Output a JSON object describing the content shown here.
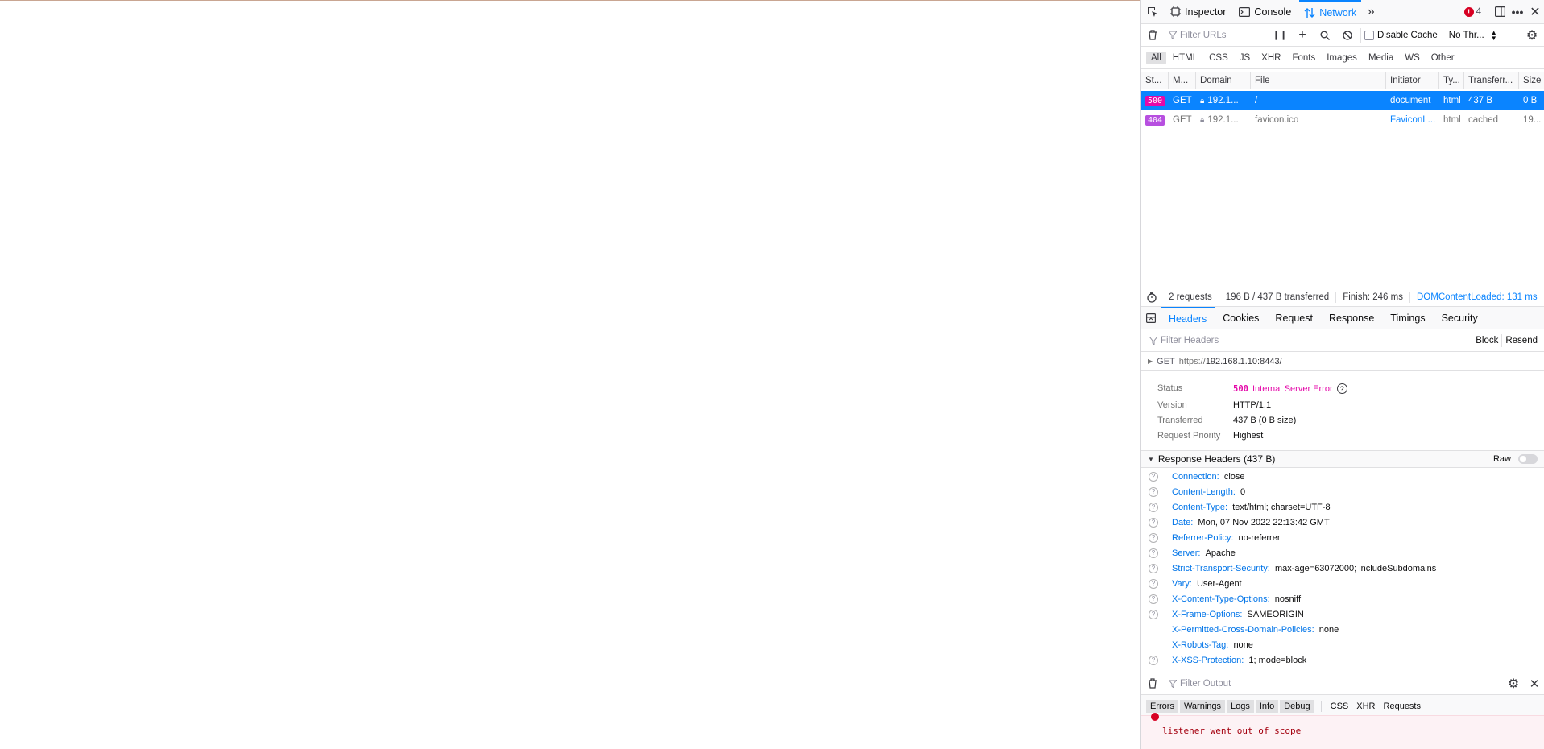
{
  "toolbar": {
    "tabs": [
      {
        "label": "Inspector",
        "icon": "inspector-icon"
      },
      {
        "label": "Console",
        "icon": "console-icon"
      },
      {
        "label": "Network",
        "icon": "network-icon"
      }
    ],
    "error_count": "4"
  },
  "filter": {
    "placeholder": "Filter URLs",
    "disable_cache": "Disable Cache",
    "throttle": "No Thr..."
  },
  "type_filters": [
    "All",
    "HTML",
    "CSS",
    "JS",
    "XHR",
    "Fonts",
    "Images",
    "Media",
    "WS",
    "Other"
  ],
  "table": {
    "headers": [
      "St...",
      "M...",
      "Domain",
      "File",
      "Initiator",
      "Ty...",
      "Transferr...",
      "Size"
    ],
    "rows": [
      {
        "status": "500",
        "method": "GET",
        "domain": "192.1...",
        "file": "/",
        "initiator": "document",
        "type": "html",
        "transferred": "437 B",
        "size": "0 B"
      },
      {
        "status": "404",
        "method": "GET",
        "domain": "192.1...",
        "file": "favicon.ico",
        "initiator": "FaviconL...",
        "type": "html",
        "transferred": "cached",
        "size": "19..."
      }
    ]
  },
  "summary": {
    "requests": "2 requests",
    "transferred": "196 B / 437 B transferred",
    "finish": "Finish: 246 ms",
    "dcl": "DOMContentLoaded: 131 ms"
  },
  "details": {
    "tabs": [
      "Headers",
      "Cookies",
      "Request",
      "Response",
      "Timings",
      "Security"
    ],
    "filter_placeholder": "Filter Headers",
    "block": "Block",
    "resend": "Resend",
    "request_method": "GET",
    "request_url_prefix": "https://",
    "request_url_host": "192.168.1.10:8443/",
    "status_label": "Status",
    "status_code": "500",
    "status_text": "Internal Server Error",
    "version_label": "Version",
    "version": "HTTP/1.1",
    "transferred_label": "Transferred",
    "transferred": "437 B (0 B size)",
    "priority_label": "Request Priority",
    "priority": "Highest",
    "response_headers_title": "Response Headers (437 B)",
    "raw_label": "Raw",
    "headers": [
      {
        "name": "Connection:",
        "value": "close",
        "help": true
      },
      {
        "name": "Content-Length:",
        "value": "0",
        "help": true
      },
      {
        "name": "Content-Type:",
        "value": "text/html; charset=UTF-8",
        "help": true
      },
      {
        "name": "Date:",
        "value": "Mon, 07 Nov 2022 22:13:42 GMT",
        "help": true
      },
      {
        "name": "Referrer-Policy:",
        "value": "no-referrer",
        "help": true
      },
      {
        "name": "Server:",
        "value": "Apache",
        "help": true
      },
      {
        "name": "Strict-Transport-Security:",
        "value": "max-age=63072000; includeSubdomains",
        "help": true
      },
      {
        "name": "Vary:",
        "value": "User-Agent",
        "help": true
      },
      {
        "name": "X-Content-Type-Options:",
        "value": "nosniff",
        "help": true
      },
      {
        "name": "X-Frame-Options:",
        "value": "SAMEORIGIN",
        "help": true
      },
      {
        "name": "X-Permitted-Cross-Domain-Policies:",
        "value": "none",
        "help": false
      },
      {
        "name": "X-Robots-Tag:",
        "value": "none",
        "help": false
      },
      {
        "name": "X-XSS-Protection:",
        "value": "1; mode=block",
        "help": true
      }
    ]
  },
  "console": {
    "filter_placeholder": "Filter Output",
    "levels": [
      "Errors",
      "Warnings",
      "Logs",
      "Info",
      "Debug"
    ],
    "categories": [
      "CSS",
      "XHR",
      "Requests"
    ],
    "message": "listener went out of scope"
  },
  "colors": {
    "accent": "#0a84ff",
    "status_500": "#e508a9",
    "status_404": "#b74fe0",
    "error": "#d70022"
  }
}
